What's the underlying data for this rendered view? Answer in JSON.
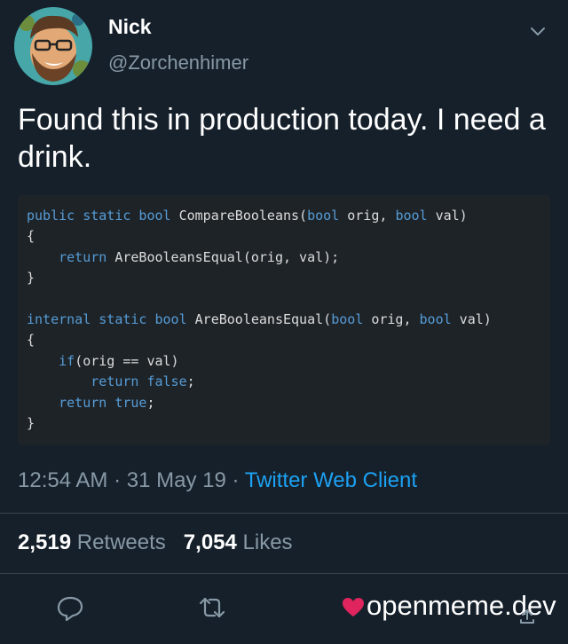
{
  "author": {
    "display_name": "Nick",
    "handle": "@Zorchenhimer"
  },
  "tweet": {
    "text": "Found this in production today.  I need a drink.",
    "time": "12:54 AM",
    "date": "31 May 19",
    "source": "Twitter Web Client"
  },
  "code": {
    "lines": [
      {
        "kw1": "public static bool",
        "txt1": " CompareBooleans(",
        "kw2": "bool",
        "txt2": " orig, ",
        "kw3": "bool",
        "txt3": " val)"
      },
      {
        "txt1": "{"
      },
      {
        "indent": "    ",
        "kw1": "return",
        "txt1": " AreBooleansEqual(orig, val);"
      },
      {
        "txt1": "}"
      },
      {
        "txt1": ""
      },
      {
        "kw1": "internal static bool",
        "txt1": " AreBooleansEqual(",
        "kw2": "bool",
        "txt2": " orig, ",
        "kw3": "bool",
        "txt3": " val)"
      },
      {
        "txt1": "{"
      },
      {
        "indent": "    ",
        "kw1": "if",
        "txt1": "(orig == val)"
      },
      {
        "indent": "        ",
        "kw1": "return false",
        "txt1": ";"
      },
      {
        "indent": "    ",
        "kw1": "return true",
        "txt1": ";"
      },
      {
        "txt1": "}"
      }
    ]
  },
  "stats": {
    "retweets_count": "2,519",
    "retweets_label": "Retweets",
    "likes_count": "7,054",
    "likes_label": "Likes"
  },
  "watermark": "openmeme.dev",
  "colors": {
    "background": "#15202b",
    "secondary_text": "#8899a6",
    "link": "#1da1f2",
    "keyword": "#569cd6",
    "heart": "#e0245e"
  },
  "icons": [
    "chevron-down-icon",
    "reply-icon",
    "retweet-icon",
    "heart-icon",
    "share-icon"
  ]
}
